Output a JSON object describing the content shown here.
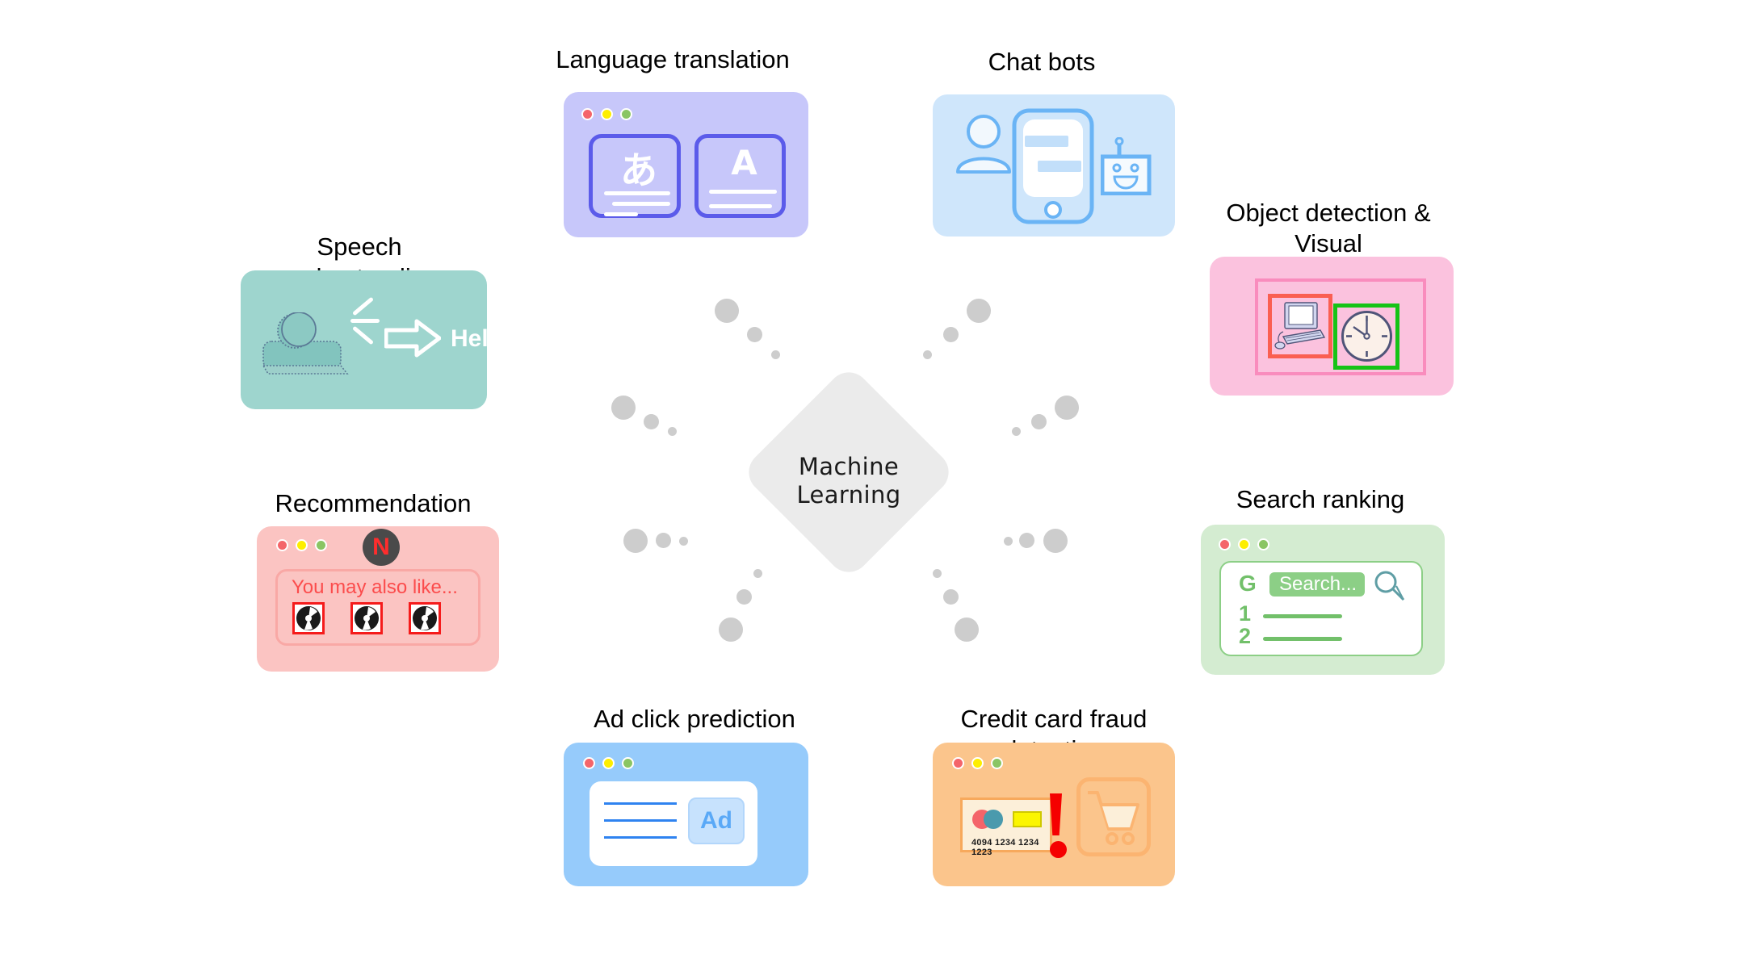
{
  "diagram": {
    "center": {
      "label": "Machine\nLearning",
      "shape": "diamond",
      "fill": "#ebebeb"
    },
    "connector_clusters": 8,
    "connector_color": "#cdcdcd",
    "cards": [
      {
        "id": "speech",
        "title": "Speech understanding",
        "bg": "#9ed5ce",
        "icons": [
          "person-speaking-icon",
          "arrow-right-icon"
        ],
        "text": "Hello"
      },
      {
        "id": "language",
        "title": "Language translation",
        "bg": "#c7c7fa",
        "accent": "#5b5bea",
        "source_glyph": "あ",
        "target_glyph": "A",
        "window_dots": [
          "red",
          "yellow",
          "green"
        ]
      },
      {
        "id": "chatbots",
        "title": "Chat bots",
        "bg": "#cfe6fb",
        "accent": "#6ab4f5",
        "icons": [
          "person-icon",
          "phone-icon",
          "robot-icon"
        ]
      },
      {
        "id": "objectdetection",
        "title": "Object detection & Visual\nunderstanding",
        "bg": "#fbc2de",
        "box_colors": [
          "#fa5f52",
          "#16c316"
        ],
        "icons": [
          "computer-icon",
          "clock-icon"
        ]
      },
      {
        "id": "recommendation",
        "title": "Recommendation systems",
        "bg": "#fbc4c2",
        "logo_letter": "N",
        "logo_bg": "#4a4a4a",
        "logo_color": "#ff2d2d",
        "body_text": "You may also like...",
        "thumbnails": 3,
        "window_dots": [
          "red",
          "yellow",
          "green"
        ]
      },
      {
        "id": "searchranking",
        "title": "Search ranking",
        "bg": "#d4ecd1",
        "accent": "#72c06a",
        "logo_letter": "G",
        "search_placeholder": "Search...",
        "ranks": [
          "1",
          "2"
        ],
        "window_dots": [
          "red",
          "yellow",
          "green"
        ]
      },
      {
        "id": "adclick",
        "title": "Ad click prediction",
        "bg": "#96cbfb",
        "accent": "#5aa9f7",
        "ad_label": "Ad",
        "text_lines": 3,
        "window_dots": [
          "red",
          "yellow",
          "green"
        ]
      },
      {
        "id": "fraud",
        "title": "Credit card fraud detection",
        "bg": "#fbc58c",
        "card_number": "4094 1234 1234 1223",
        "alert_icon": "exclamation-icon",
        "alert_color": "#f50000",
        "cart_icon": "shopping-cart-icon",
        "window_dots": [
          "red",
          "yellow",
          "green"
        ]
      }
    ]
  }
}
